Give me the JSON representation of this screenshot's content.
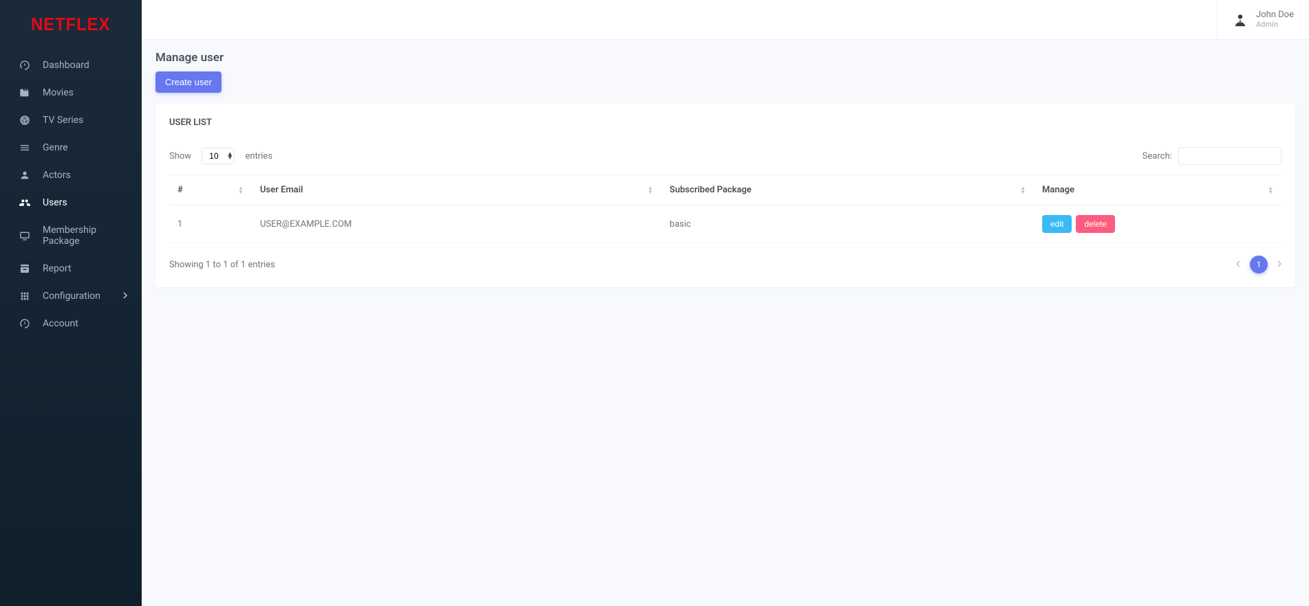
{
  "brand": "NETFLEX",
  "header": {
    "user_name": "John Doe",
    "user_role": "Admin"
  },
  "sidebar": {
    "items": [
      {
        "label": "Dashboard",
        "icon": "dashboard-icon"
      },
      {
        "label": "Movies",
        "icon": "movies-icon"
      },
      {
        "label": "TV Series",
        "icon": "tvseries-icon"
      },
      {
        "label": "Genre",
        "icon": "genre-icon"
      },
      {
        "label": "Actors",
        "icon": "actors-icon"
      },
      {
        "label": "Users",
        "icon": "users-icon",
        "active": true
      },
      {
        "label": "Membership Package",
        "icon": "membership-icon"
      },
      {
        "label": "Report",
        "icon": "report-icon"
      },
      {
        "label": "Configuration",
        "icon": "configuration-icon",
        "has_children": true
      },
      {
        "label": "Account",
        "icon": "account-icon"
      }
    ]
  },
  "page": {
    "title": "Manage user",
    "create_button": "Create user",
    "card_title": "USER LIST"
  },
  "datatable": {
    "length_prefix": "Show",
    "length_suffix": "entries",
    "length_value": "10",
    "search_label": "Search:",
    "columns": {
      "index": "#",
      "email": "User Email",
      "package": "Subscribed Package",
      "manage": "Manage"
    },
    "rows": [
      {
        "index": "1",
        "email": "USER@EXAMPLE.COM",
        "package": "basic"
      }
    ],
    "actions": {
      "edit": "edit",
      "delete": "delete"
    },
    "info": "Showing 1 to 1 of 1 entries",
    "pagination": {
      "current": "1"
    }
  }
}
